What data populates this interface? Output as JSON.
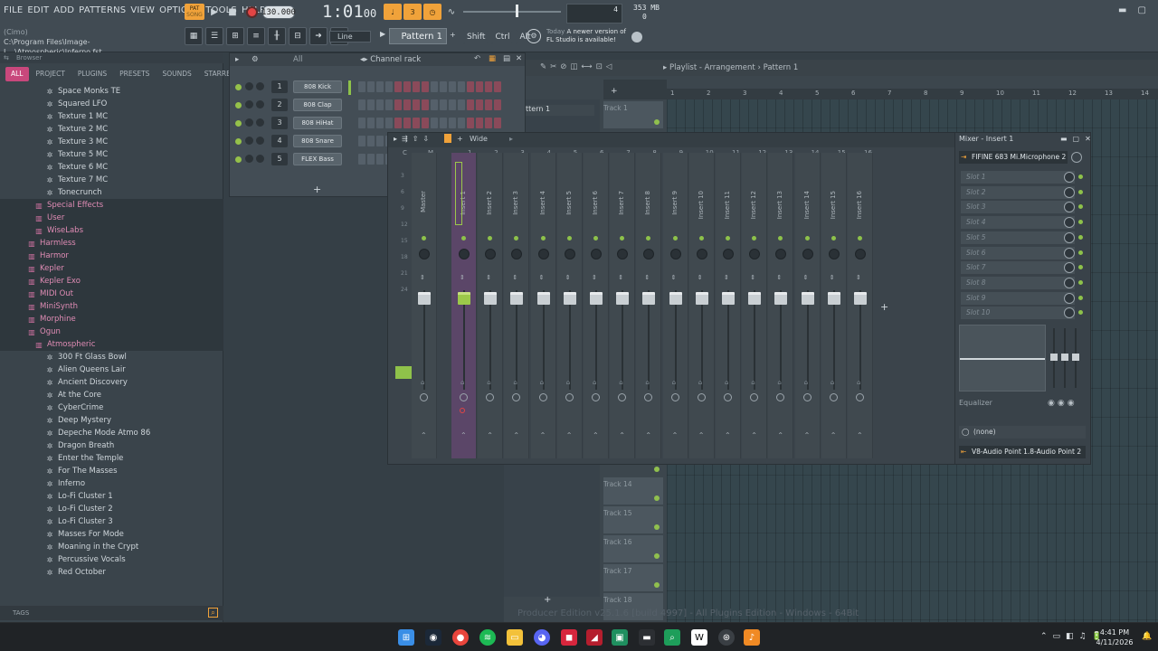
{
  "menu": [
    "FILE",
    "EDIT",
    "ADD",
    "PATTERNS",
    "VIEW",
    "OPTIONS",
    "TOOLS",
    "HELP"
  ],
  "project": {
    "title_tag": "(Cimo)",
    "path": "C:\\Program Files\\Image-L...\\Atmospheric\\Inferno.fst"
  },
  "transport": {
    "pat_label": "PAT",
    "song_label": "SONG",
    "tempo": "130.000",
    "time": "1:01",
    "time_sub": "00",
    "cpu": "4",
    "mem": "353 MB",
    "mem_sub": "0"
  },
  "toolbar": {
    "snap": "Line",
    "pattern": "Pattern 1",
    "shift": "Shift",
    "ctrl": "Ctrl",
    "alt": "Alt",
    "news_date": "Today",
    "news_text_1": "A newer version of",
    "news_text_2": "FL Studio is available!"
  },
  "browser": {
    "title": "Browser",
    "tabs": [
      "ALL",
      "PROJECT",
      "PLUGINS",
      "PRESETS",
      "SOUNDS",
      "STARRED"
    ],
    "items": [
      {
        "label": "Space Monks TE",
        "type": "preset",
        "indent": 1
      },
      {
        "label": "Squared LFO",
        "type": "preset",
        "indent": 1
      },
      {
        "label": "Texture 1 MC",
        "type": "preset",
        "indent": 1
      },
      {
        "label": "Texture 2 MC",
        "type": "preset",
        "indent": 1
      },
      {
        "label": "Texture 3 MC",
        "type": "preset",
        "indent": 1
      },
      {
        "label": "Texture 5 MC",
        "type": "preset",
        "indent": 1
      },
      {
        "label": "Texture 6 MC",
        "type": "preset",
        "indent": 1
      },
      {
        "label": "Texture 7 MC",
        "type": "preset",
        "indent": 1
      },
      {
        "label": "Tonecrunch",
        "type": "preset",
        "indent": 1
      },
      {
        "label": "Special Effects",
        "type": "folder",
        "indent": 0
      },
      {
        "label": "User",
        "type": "folder",
        "indent": 0
      },
      {
        "label": "WiseLabs",
        "type": "folder",
        "indent": 0
      },
      {
        "label": "Harmless",
        "type": "folder",
        "indent": -1
      },
      {
        "label": "Harmor",
        "type": "folder",
        "indent": -1
      },
      {
        "label": "Kepler",
        "type": "folder",
        "indent": -1
      },
      {
        "label": "Kepler Exo",
        "type": "folder",
        "indent": -1
      },
      {
        "label": "MIDI Out",
        "type": "folder",
        "indent": -1
      },
      {
        "label": "MiniSynth",
        "type": "folder",
        "indent": -1
      },
      {
        "label": "Morphine",
        "type": "folder",
        "indent": -1
      },
      {
        "label": "Ogun",
        "type": "folder",
        "indent": -1
      },
      {
        "label": "Atmospheric",
        "type": "folder",
        "indent": 0
      },
      {
        "label": "300 Ft Glass Bowl",
        "type": "preset",
        "indent": 1
      },
      {
        "label": "Alien Queens Lair",
        "type": "preset",
        "indent": 1
      },
      {
        "label": "Ancient Discovery",
        "type": "preset",
        "indent": 1
      },
      {
        "label": "At the Core",
        "type": "preset",
        "indent": 1
      },
      {
        "label": "CyberCrime",
        "type": "preset",
        "indent": 1
      },
      {
        "label": "Deep Mystery",
        "type": "preset",
        "indent": 1
      },
      {
        "label": "Depeche Mode Atmo 86",
        "type": "preset",
        "indent": 1
      },
      {
        "label": "Dragon Breath",
        "type": "preset",
        "indent": 1
      },
      {
        "label": "Enter the Temple",
        "type": "preset",
        "indent": 1
      },
      {
        "label": "For The Masses",
        "type": "preset",
        "indent": 1
      },
      {
        "label": "Inferno",
        "type": "preset",
        "indent": 1
      },
      {
        "label": "Lo-Fi Cluster 1",
        "type": "preset",
        "indent": 1
      },
      {
        "label": "Lo-Fi Cluster 2",
        "type": "preset",
        "indent": 1
      },
      {
        "label": "Lo-Fi Cluster 3",
        "type": "preset",
        "indent": 1
      },
      {
        "label": "Masses For Mode",
        "type": "preset",
        "indent": 1
      },
      {
        "label": "Moaning in the Crypt",
        "type": "preset",
        "indent": 1
      },
      {
        "label": "Percussive Vocals",
        "type": "preset",
        "indent": 1
      },
      {
        "label": "Red October",
        "type": "preset",
        "indent": 1
      }
    ],
    "tags_label": "TAGS"
  },
  "channel_rack": {
    "title": "Channel rack",
    "filter": "All",
    "channels": [
      {
        "num": "1",
        "name": "808 Kick"
      },
      {
        "num": "2",
        "name": "808 Clap"
      },
      {
        "num": "3",
        "name": "808 HiHat"
      },
      {
        "num": "4",
        "name": "808 Snare"
      },
      {
        "num": "5",
        "name": "FLEX Bass"
      }
    ],
    "add_label": "+"
  },
  "playlist": {
    "title": "Playlist - Arrangement",
    "pattern": "Pattern 1",
    "pattern_item": "ttern 1",
    "ruler": [
      "1",
      "2",
      "3",
      "4",
      "5",
      "6",
      "7",
      "8",
      "9",
      "10",
      "11",
      "12",
      "13",
      "14"
    ],
    "tracks_top": [
      "Track 1"
    ],
    "tracks_bottom": [
      "Track 14",
      "Track 15",
      "Track 16",
      "Track 17",
      "Track 18"
    ],
    "add_label": "+"
  },
  "mixer": {
    "view": "Wide",
    "title": "Mixer - Insert 1",
    "columns_header": [
      "C",
      "M",
      "1",
      "2",
      "3",
      "4",
      "5",
      "6",
      "7",
      "8",
      "9",
      "10",
      "11",
      "12",
      "13",
      "14",
      "15",
      "16"
    ],
    "strips": [
      "Master",
      "Insert 1",
      "Insert 2",
      "Insert 3",
      "Insert 4",
      "Insert 5",
      "Insert 6",
      "Insert 7",
      "Insert 8",
      "Insert 9",
      "Insert 10",
      "Insert 11",
      "Insert 12",
      "Insert 13",
      "Insert 14",
      "Insert 15",
      "Insert 16"
    ],
    "scale": [
      "3",
      "6",
      "9",
      "12",
      "15",
      "18",
      "21",
      "24"
    ],
    "input": "FIFINE 683 Mi.Microphone 2",
    "slots": [
      "Slot 1",
      "Slot 2",
      "Slot 3",
      "Slot 4",
      "Slot 5",
      "Slot 6",
      "Slot 7",
      "Slot 8",
      "Slot 9",
      "Slot 10"
    ],
    "eq_label": "Equalizer",
    "none_label": "(none)",
    "output": "V8-Audio Point 1.8-Audio Point 2"
  },
  "watermark": "Producer Edition v25.1.6 [build 4997] - All Plugins Edition - Windows - 64Bit",
  "taskbar": {
    "time": "4:41 PM",
    "date": "4/11/2026"
  },
  "colors": {
    "accent": "#f0a23a",
    "browser_tab": "#c8487c",
    "led": "#8ec24a",
    "selected_strip": "#5b4668"
  }
}
